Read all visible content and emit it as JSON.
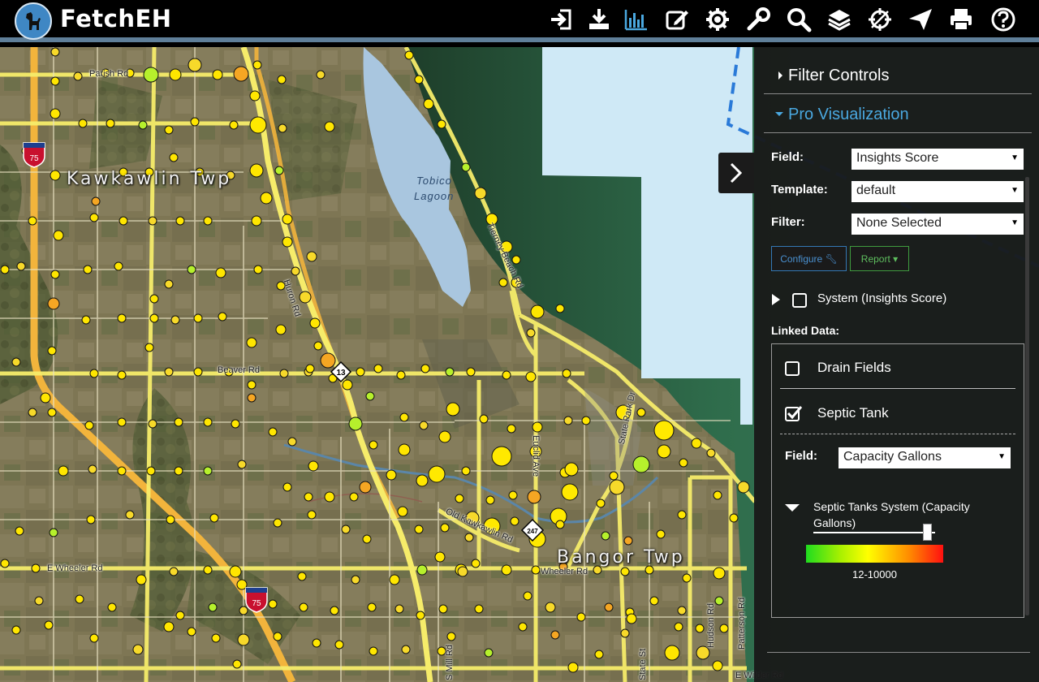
{
  "app": {
    "title": "FetchEH"
  },
  "toolbar": [
    {
      "name": "login-icon",
      "active": false
    },
    {
      "name": "download-icon",
      "active": false
    },
    {
      "name": "bar-chart-icon",
      "active": true
    },
    {
      "name": "edit-icon",
      "active": false
    },
    {
      "name": "gear-icon",
      "active": false
    },
    {
      "name": "wrench-icon",
      "active": false
    },
    {
      "name": "search-icon",
      "active": false
    },
    {
      "name": "layers-icon",
      "active": false
    },
    {
      "name": "crosshair-icon",
      "active": false
    },
    {
      "name": "send-icon",
      "active": false
    },
    {
      "name": "print-icon",
      "active": false
    },
    {
      "name": "help-icon",
      "active": false
    }
  ],
  "colors": {
    "accent": "#4aa8e0",
    "toolbar_active": "#4aa8e0",
    "road": "#f6ec6a",
    "highway": "#f2b43c",
    "water": "#cfe9f6",
    "lagoon": "#a9c6df",
    "panel_bg": "#181818"
  },
  "map": {
    "labels": {
      "twp_west": "Kawkawlin Twp",
      "twp_east": "Bangor Twp",
      "lagoon": [
        "Tobico",
        "Lagoon"
      ],
      "roads": [
        "Parish Rd",
        "Beaver Rd",
        "E Wheeler Rd",
        "Wheeler Rd",
        "E Wilder Rd",
        "Huron Rd",
        "Tierney Beach Rd",
        "Euclid Ave",
        "Old Kawkawlin Rd",
        "State Park Dr",
        "State St",
        "Patterson Rd",
        "Mulholland Rd",
        "S Mill Rd",
        "Hudson Rd"
      ],
      "shields": {
        "interstate": "75",
        "m13": "13",
        "m247": "247"
      }
    }
  },
  "panel": {
    "filter_controls": "Filter Controls",
    "pro_visualization": "Pro Visualization",
    "field_label": "Field:",
    "field_value": "Insights Score",
    "template_label": "Template:",
    "template_value": "default",
    "filter_label": "Filter:",
    "filter_value": "None Selected",
    "configure_btn": "Configure",
    "report_btn": "Report",
    "system_layer": "System (Insights Score)",
    "linked_data_label": "Linked Data:",
    "linked": {
      "drain_fields": "Drain Fields",
      "drain_fields_checked": false,
      "septic_tank": "Septic Tank",
      "septic_tank_checked": true,
      "field_label": "Field:",
      "field_value": "Capacity Gallons",
      "legend_title": "Septic Tanks System (Capacity Gallons)",
      "legend_range": "12-10000",
      "opacity_slider": 0.93
    }
  }
}
